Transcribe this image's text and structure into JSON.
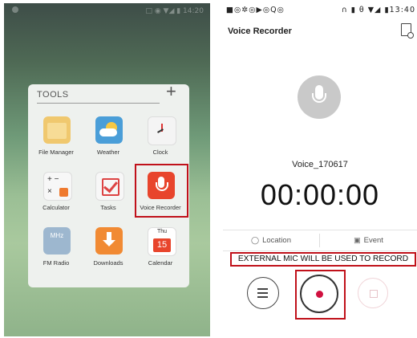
{
  "left_screen": {
    "status_text": "□ ◉ ▼◢ ▮ 14:20",
    "folder": {
      "title": "TOOLS",
      "add_symbol": "+",
      "apps": [
        {
          "label": "File Manager",
          "icon": "file-manager-icon"
        },
        {
          "label": "Weather",
          "icon": "weather-icon"
        },
        {
          "label": "Clock",
          "icon": "clock-icon"
        },
        {
          "label": "Calculator",
          "icon": "calculator-icon"
        },
        {
          "label": "Tasks",
          "icon": "tasks-icon"
        },
        {
          "label": "Voice Recorder",
          "icon": "voice-recorder-icon"
        },
        {
          "label": "FM Radio",
          "icon": "fm-radio-icon",
          "icon_text": "MHz"
        },
        {
          "label": "Downloads",
          "icon": "downloads-icon"
        },
        {
          "label": "Calendar",
          "icon": "calendar-icon",
          "day": "Thu",
          "date": "15"
        }
      ]
    },
    "highlight_color": "#c0111a"
  },
  "right_screen": {
    "status_left": "■◎✲◎▶◎Q◎",
    "status_right": "∩ ▮ θ ▼◢ ▮13:40",
    "app_title": "Voice Recorder",
    "recording_name": "Voice_170617",
    "timer": "00:00:00",
    "location_label": "Location",
    "event_label": "Event",
    "external_mic_notice": "EXTERNAL MIC WILL  BE USED TO RECORD",
    "record_color": "#d0103f",
    "highlight_color": "#c0111a"
  }
}
